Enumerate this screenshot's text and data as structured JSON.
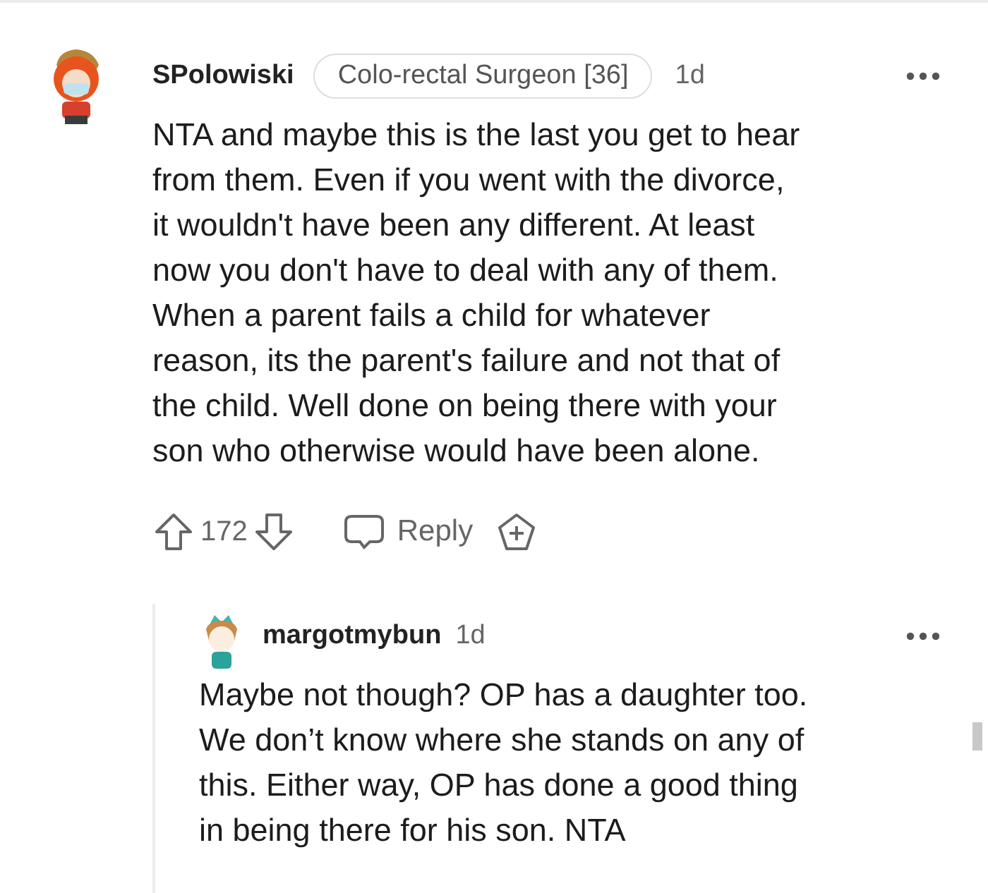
{
  "comments": [
    {
      "username": "SPolowiski",
      "flair": "Colo-rectal Surgeon [36]",
      "time": "1d",
      "body": "NTA and maybe this is the last you get to hear\nfrom them. Even if you went with the divorce,\nit wouldn't have been any different. At least\nnow you don't have to deal with any of them.\nWhen a parent fails a child for whatever\nreason, its the parent's failure and not that of\nthe child. Well done on being there with your\nson who otherwise would have been alone.",
      "score": "172",
      "reply_label": "Reply"
    },
    {
      "username": "margotmybun",
      "time": "1d",
      "body": "Maybe not though? OP has a daughter too.\nWe don’t know where she stands on any of\nthis. Either way, OP has done a good thing\nin being there for his son. NTA"
    }
  ]
}
